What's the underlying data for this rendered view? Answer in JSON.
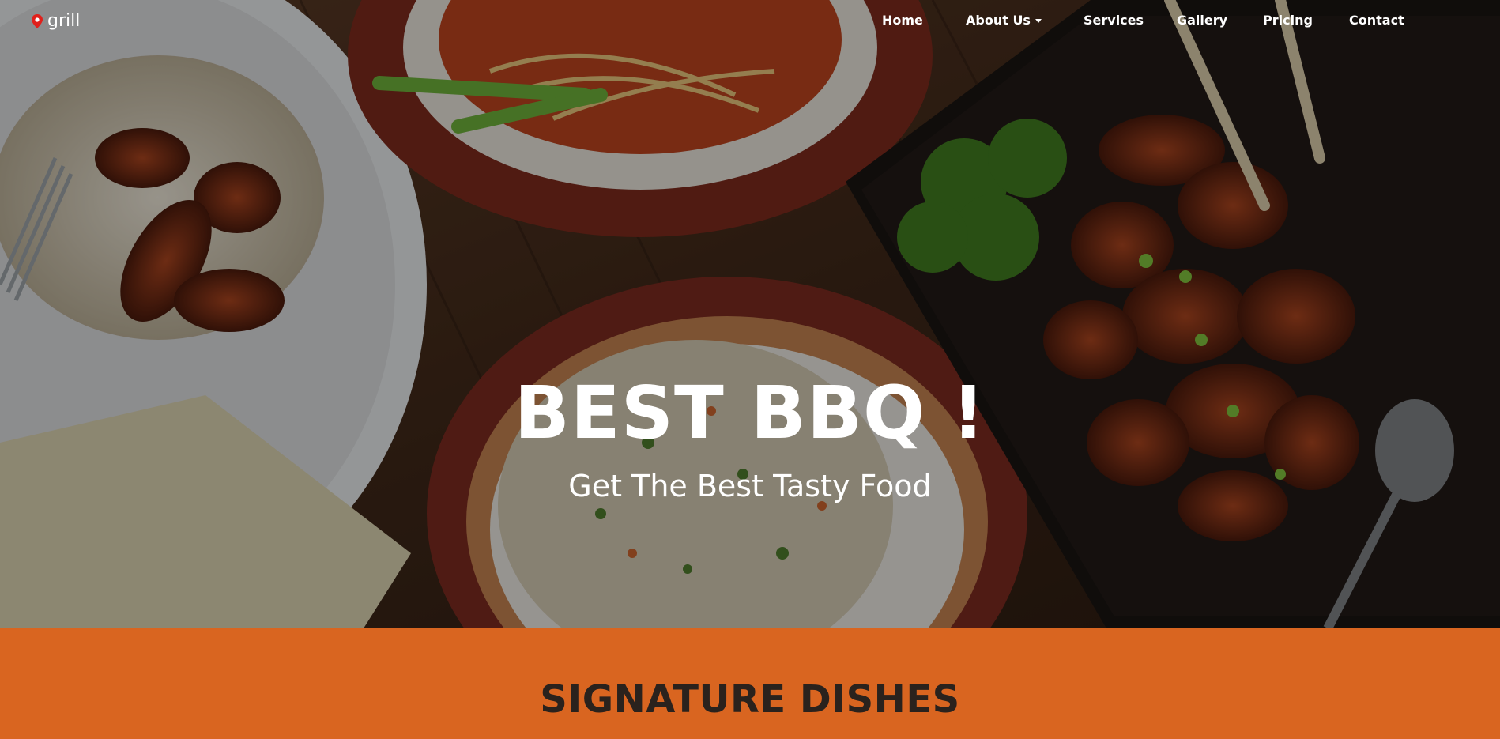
{
  "brand": {
    "name": "grill",
    "icon": "map-pin-icon"
  },
  "nav": {
    "items": [
      {
        "label": "Home"
      },
      {
        "label": "About Us",
        "dropdown": true
      },
      {
        "label": "Services"
      },
      {
        "label": "Gallery"
      },
      {
        "label": "Pricing"
      },
      {
        "label": "Contact"
      }
    ]
  },
  "hero": {
    "title": "BEST BBQ !",
    "subtitle": "Get The Best Tasty Food"
  },
  "section": {
    "title": "SIGNATURE DISHES"
  },
  "colors": {
    "accent_orange": "#d96520",
    "pin_red": "#e0201b",
    "heading_dark": "#2a221d",
    "hero_text": "#ffffff"
  }
}
